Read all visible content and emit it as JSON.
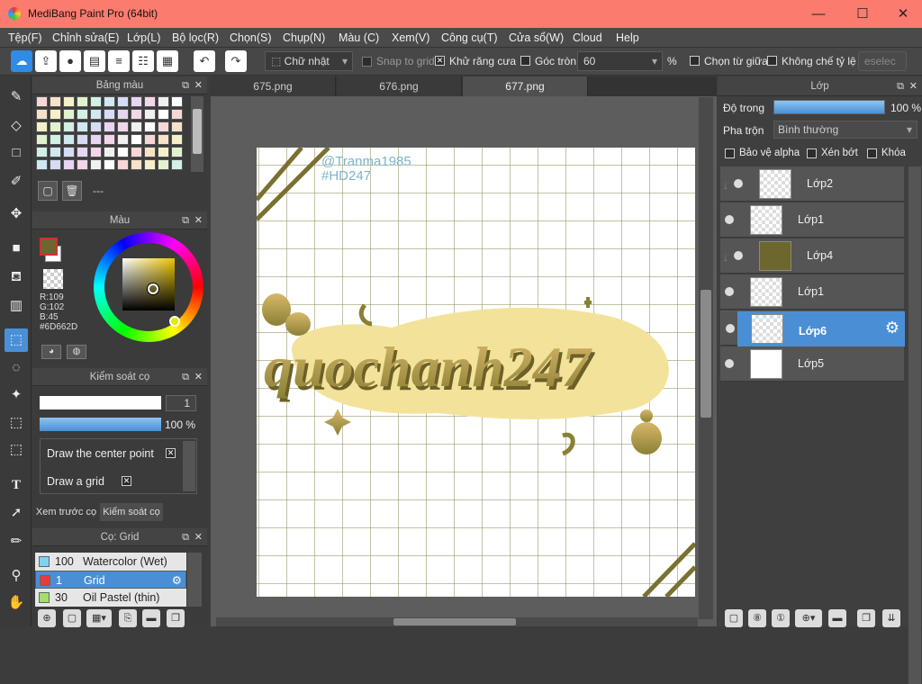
{
  "window": {
    "title": "MediBang Paint Pro (64bit)",
    "minimize": "—",
    "maximize": "☐",
    "close": "✕"
  },
  "menu": [
    "Tệp(F)",
    "Chỉnh sửa(E)",
    "Lớp(L)",
    "Bộ lọc(R)",
    "Chọn(S)",
    "Chụp(N)",
    "Màu (C)",
    "Xem(V)",
    "Công cụ(T)",
    "Cửa sổ(W)",
    "Cloud",
    "Help"
  ],
  "toolbar": {
    "selection_mode": "Chữ nhật",
    "snap_to_grid": "Snap to grid",
    "antialias": "Khử răng cưa",
    "round_corner": "Góc tròn",
    "round_value": "60",
    "percent": "%",
    "from_center": "Chọn từ giữa",
    "no_ratio": "Không chế tỷ lệ",
    "deselect": "eselec"
  },
  "tabs": [
    "675.png",
    "676.png",
    "677.png"
  ],
  "palette_panel": {
    "title": "Bảng màu",
    "name": "---"
  },
  "color_panel": {
    "title": "Màu",
    "r": "R:109",
    "g": "G:102",
    "b": "B:45",
    "hex": "#6D662D",
    "current": "#6D662D"
  },
  "brush_control": {
    "title": "Kiểm soát cọ",
    "size": "1",
    "opacity": "100 %",
    "option1": "Draw the center point",
    "option2": "Draw a grid",
    "tab1": "Xem trước cọ",
    "tab2": "Kiểm soát cọ"
  },
  "brush_panel": {
    "title": "Cọ: Grid",
    "items": [
      {
        "size": "100",
        "name": "Watercolor (Wet)",
        "color": "#7fd3f0"
      },
      {
        "size": "1",
        "name": "Grid",
        "color": "#e83c3c"
      },
      {
        "size": "30",
        "name": "Oil Pastel (thin)",
        "color": "#a4de6c"
      }
    ]
  },
  "artwork": {
    "credit1": "@Tranma1985",
    "credit2": "#HD247",
    "main_text": "quochanh247"
  },
  "layer_panel": {
    "title": "Lớp",
    "opacity_label": "Độ trong",
    "opacity_value": "100 %",
    "opacity_fraction": 1.0,
    "blend_label": "Pha trộn",
    "blend_value": "Bình thường",
    "protect_alpha": "Bảo vệ alpha",
    "clip": "Xén bớt",
    "lock": "Khóa",
    "layers": [
      {
        "name": "Lớp2",
        "selected": false
      },
      {
        "name": "Lớp1",
        "selected": false
      },
      {
        "name": "Lớp4",
        "selected": false
      },
      {
        "name": "Lớp1",
        "selected": false
      },
      {
        "name": "Lớp6",
        "selected": true
      },
      {
        "name": "Lớp5",
        "selected": false
      }
    ]
  }
}
